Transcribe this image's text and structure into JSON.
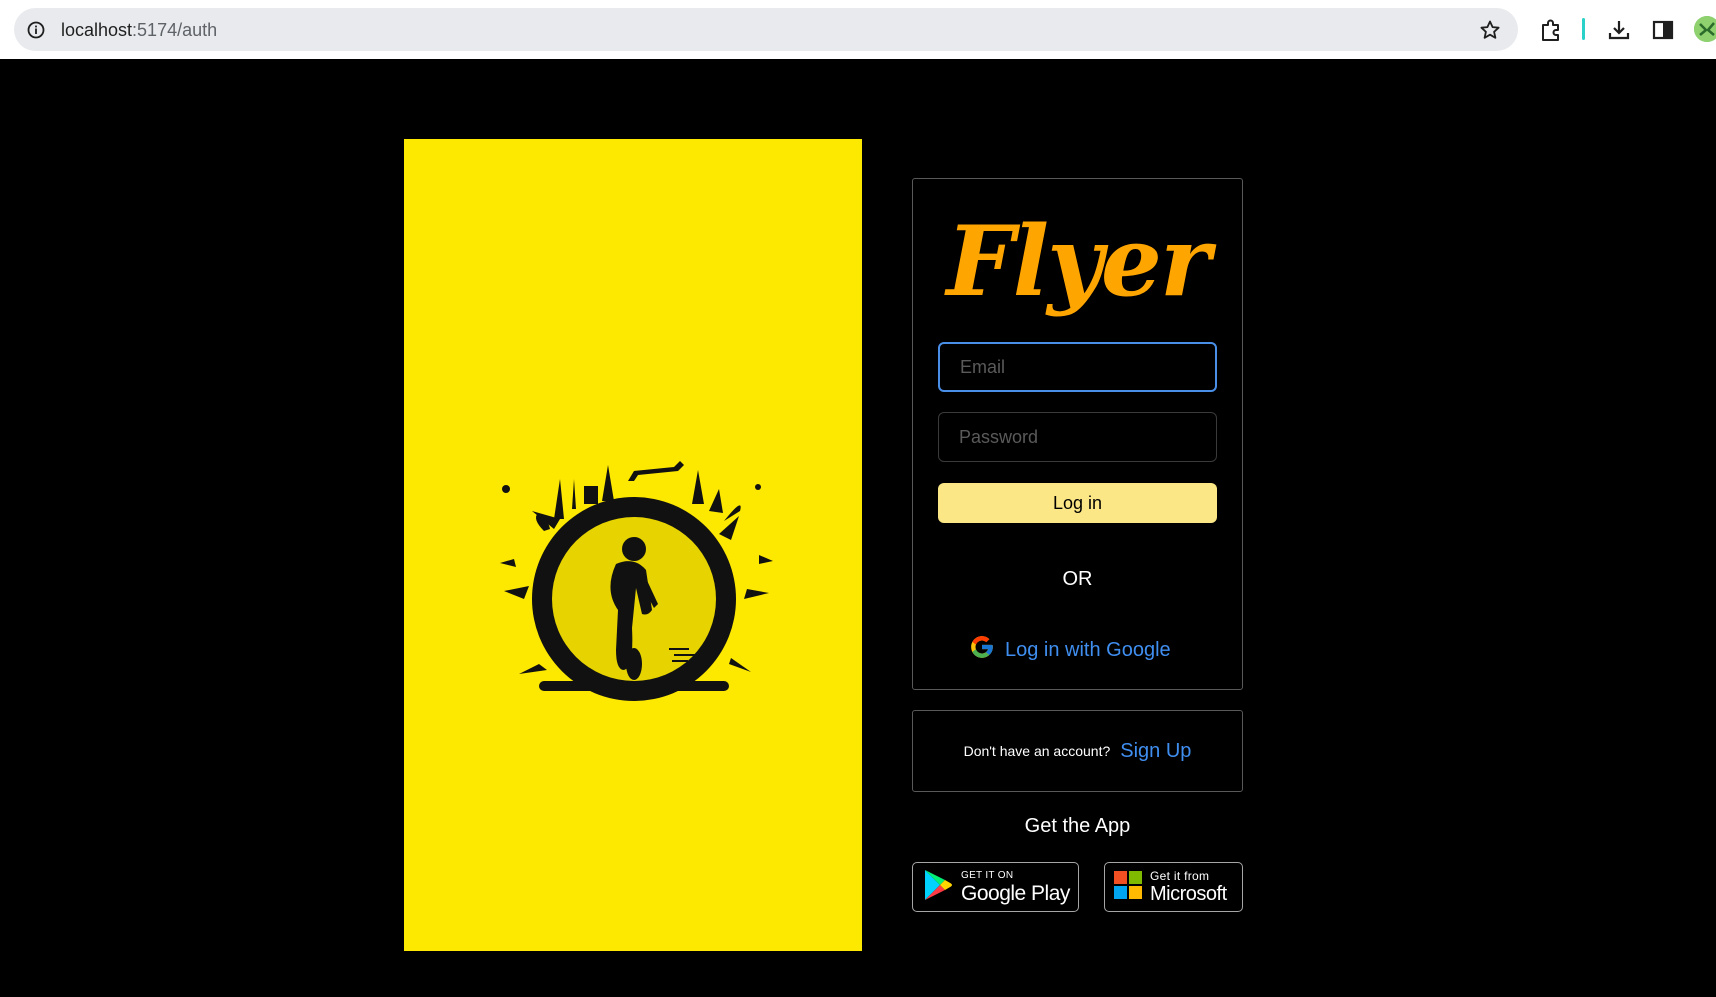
{
  "browser": {
    "url_host": "localhost",
    "url_path": ":5174/auth"
  },
  "login": {
    "logo_text": "Flyer",
    "email_placeholder": "Email",
    "email_value": "",
    "password_placeholder": "Password",
    "password_value": "",
    "login_button_label": "Log in",
    "or_text": "OR",
    "google_login_label": "Log in with Google"
  },
  "signup": {
    "prompt": "Don't have an account?",
    "link_label": "Sign Up"
  },
  "get_app": {
    "heading": "Get the App",
    "google_play": {
      "small": "GET IT ON",
      "big": "Google Play"
    },
    "microsoft": {
      "small": "Get it from",
      "big": "Microsoft"
    }
  },
  "colors": {
    "hero_background": "#fde800",
    "logo": "#ffa500",
    "link": "#3f8ef0",
    "login_button": "#fbe785",
    "focus_border": "#4a8fe7"
  },
  "icons": [
    "info-icon",
    "star-icon",
    "extensions-icon",
    "download-icon",
    "side-panel-icon",
    "profile-icon",
    "google-g-icon",
    "google-play-icon",
    "microsoft-icon"
  ]
}
